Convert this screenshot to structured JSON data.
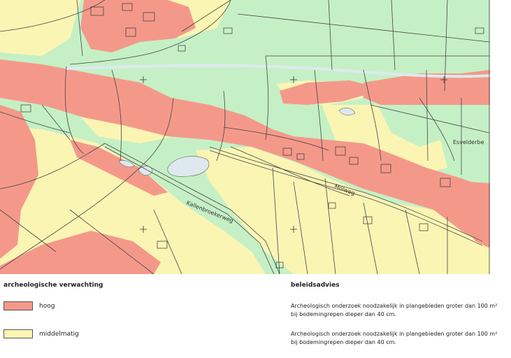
{
  "map": {
    "street_labels": [
      "Kallenbroekerweg",
      "Molweg",
      "Esvelderbe"
    ],
    "colors": {
      "hoog": "#f4998a",
      "middelmatig": "#fbf5b4",
      "laag": "#c5f0c5",
      "water": "#dde9ee",
      "lines": "#444444"
    }
  },
  "legend": {
    "title_left": "archeologische verwachting",
    "title_right": "beleidsadvies",
    "items": [
      {
        "label": "hoog",
        "color": "#f4998a",
        "advice_line1": "Archeologisch onderzoek noodzakelijk in plangebieden groter dan 100 m²",
        "advice_line2": "bij bodemingrepen dieper dan 40 cm."
      },
      {
        "label": "middelmatig",
        "color": "#fbf5b4",
        "advice_line1": "Archeologisch onderzoek noodzakelijk in plangebieden groter dan 100 m²",
        "advice_line2": "bij bodemingrepen dieper dan 40 cm."
      }
    ]
  }
}
